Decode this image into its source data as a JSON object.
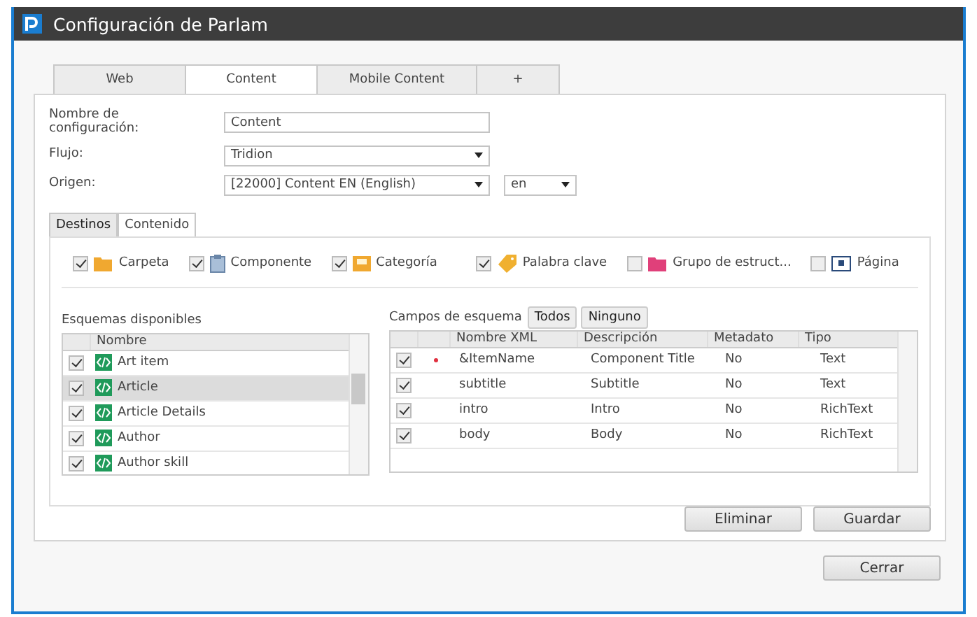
{
  "window": {
    "title": "Configuración de Parlam"
  },
  "tabs": [
    {
      "label": "Web",
      "selected": false
    },
    {
      "label": "Content",
      "selected": true
    },
    {
      "label": "Mobile Content",
      "selected": false
    },
    {
      "label": "+",
      "selected": false
    }
  ],
  "form": [
    {
      "label": "Nombre de configuración:",
      "kind": "text",
      "value": "Content"
    },
    {
      "label": "Flujo:",
      "kind": "select",
      "value": "Tridion"
    },
    {
      "label": "Origen:",
      "kind": "select",
      "value": "[22000] Content EN (English)",
      "extra": "en"
    }
  ],
  "inner_tabs": [
    {
      "label": "Destinos",
      "selected": true
    },
    {
      "label": "Contenido",
      "selected": false
    }
  ],
  "item_types": [
    {
      "label": "Carpeta",
      "checked": true,
      "kind": "folder"
    },
    {
      "label": "Componente",
      "checked": true,
      "kind": "component"
    },
    {
      "label": "Categoría",
      "checked": true,
      "kind": "category"
    },
    {
      "label": "Palabra clave",
      "checked": true,
      "kind": "keyword"
    },
    {
      "label": "Grupo de estruct...",
      "checked": false,
      "kind": "structure-group"
    },
    {
      "label": "Página",
      "checked": false,
      "kind": "page"
    }
  ],
  "schemas": {
    "title": "Esquemas disponibles",
    "column": "Nombre",
    "rows": [
      {
        "name": "Art item",
        "checked": true,
        "selected": false
      },
      {
        "name": "Article",
        "checked": true,
        "selected": true
      },
      {
        "name": "Article Details",
        "checked": true,
        "selected": false
      },
      {
        "name": "Author",
        "checked": true,
        "selected": false
      },
      {
        "name": "Author skill",
        "checked": true,
        "selected": false
      }
    ]
  },
  "fields": {
    "title": "Campos de esquema",
    "buttons": [
      "Todos",
      "Ninguno"
    ],
    "columns": [
      "Nombre XML",
      "Descripción",
      "Metadato",
      "Tipo"
    ],
    "rows": [
      {
        "checked": true,
        "required": true,
        "cells": [
          "&ItemName",
          "Component Title",
          "No",
          "Text"
        ]
      },
      {
        "checked": true,
        "required": false,
        "cells": [
          "subtitle",
          "Subtitle",
          "No",
          "Text"
        ]
      },
      {
        "checked": true,
        "required": false,
        "cells": [
          "intro",
          "Intro",
          "No",
          "RichText"
        ]
      },
      {
        "checked": true,
        "required": false,
        "cells": [
          "body",
          "Body",
          "No",
          "RichText"
        ]
      }
    ]
  },
  "actions": [
    "Eliminar",
    "Guardar"
  ],
  "close": "Cerrar"
}
